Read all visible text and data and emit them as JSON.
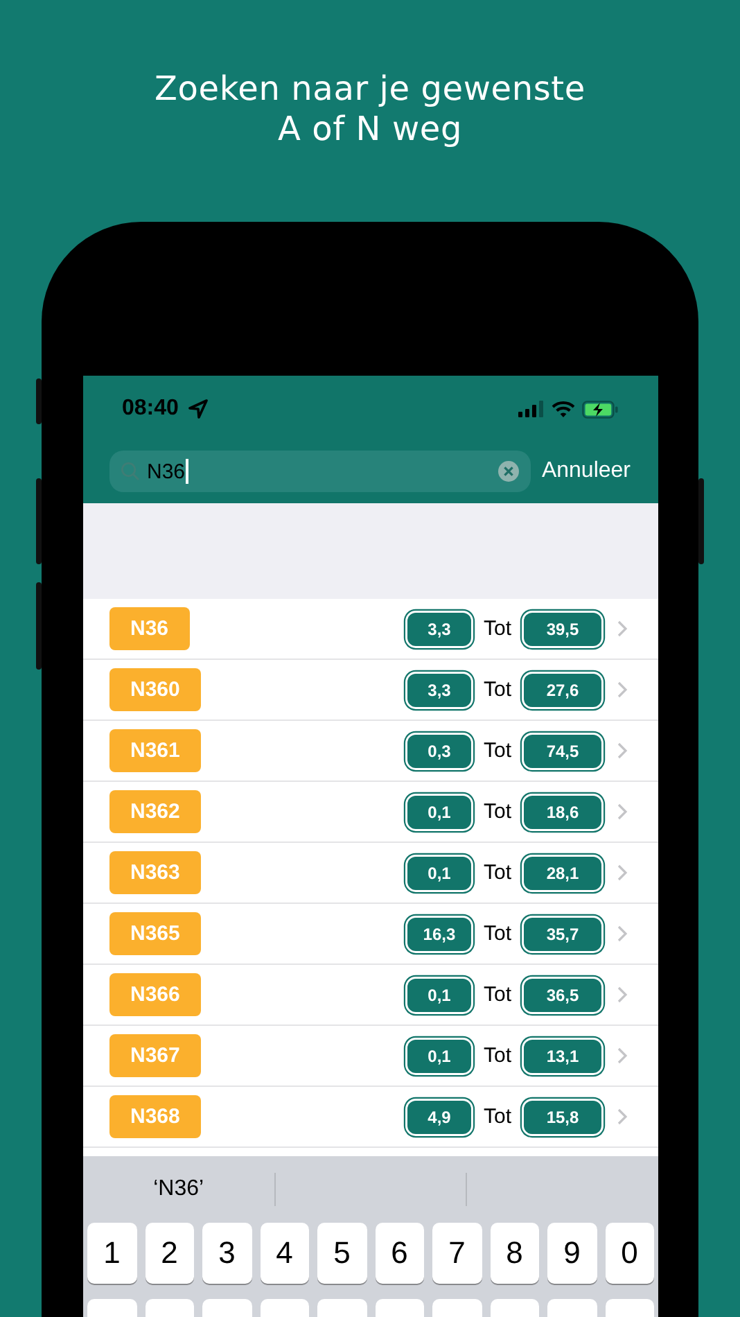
{
  "headline": [
    "Zoeken naar je gewenste",
    "A of N weg"
  ],
  "status_bar": {
    "time": "08:40"
  },
  "search": {
    "value": "N36",
    "cancel": "Annuleer"
  },
  "roads": [
    {
      "road": "N36",
      "from": "3,3",
      "connector": "Tot",
      "to": "39,5"
    },
    {
      "road": "N360",
      "from": "3,3",
      "connector": "Tot",
      "to": "27,6"
    },
    {
      "road": "N361",
      "from": "0,3",
      "connector": "Tot",
      "to": "74,5"
    },
    {
      "road": "N362",
      "from": "0,1",
      "connector": "Tot",
      "to": "18,6"
    },
    {
      "road": "N363",
      "from": "0,1",
      "connector": "Tot",
      "to": "28,1"
    },
    {
      "road": "N365",
      "from": "16,3",
      "connector": "Tot",
      "to": "35,7"
    },
    {
      "road": "N366",
      "from": "0,1",
      "connector": "Tot",
      "to": "36,5"
    },
    {
      "road": "N367",
      "from": "0,1",
      "connector": "Tot",
      "to": "13,1"
    },
    {
      "road": "N368",
      "from": "4,9",
      "connector": "Tot",
      "to": "15,8"
    }
  ],
  "keyboard": {
    "suggestions": [
      "‘N36’"
    ],
    "keys": [
      "1",
      "2",
      "3",
      "4",
      "5",
      "6",
      "7",
      "8",
      "9",
      "0"
    ]
  }
}
